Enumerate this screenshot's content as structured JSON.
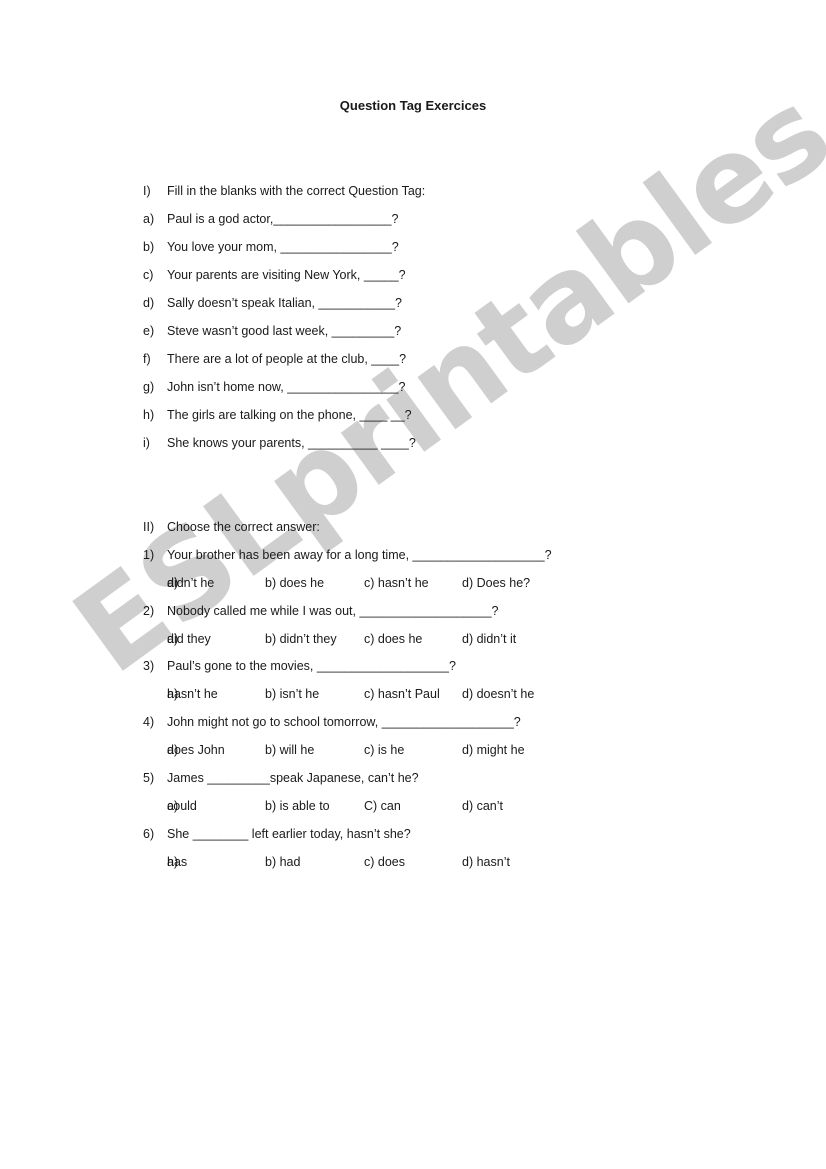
{
  "watermark": "ESLprintables.com",
  "title": "Question Tag Exercices",
  "section1": {
    "num": "I)",
    "heading": "Fill in the blanks with the correct Question Tag:",
    "items": [
      {
        "num": "a)",
        "text": "Paul is a god actor,_________________?"
      },
      {
        "num": "b)",
        "text": "You love your mom, ________________?"
      },
      {
        "num": "c)",
        "text": "Your parents are visiting New York, _____?"
      },
      {
        "num": "d)",
        "text": "Sally doesn’t speak Italian, ___________?"
      },
      {
        "num": "e)",
        "text": "Steve wasn’t good last week, _________?"
      },
      {
        "num": "f)",
        "text": "There are a lot of people at the club, ____?"
      },
      {
        "num": "g)",
        "text": "John isn’t home now, ________________?"
      },
      {
        "num": "h)",
        "text": "The girls are talking on the phone, ____ __?"
      },
      {
        "num": "i)",
        "text": "She knows your parents, __________ ____?"
      }
    ]
  },
  "section2": {
    "num": "II)",
    "heading": "Choose the correct answer:",
    "questions": [
      {
        "num": "1)",
        "text": "Your brother has been away for a long time, ___________________?",
        "options": [
          "a)",
          "didn’t he",
          "b) does he",
          "c) hasn’t he",
          "d) Does he?"
        ]
      },
      {
        "num": "2)",
        "text": "Nobody called me while I was out, ___________________?",
        "options": [
          "a)",
          "did they",
          "b) didn’t they",
          "c) does he",
          "d) didn’t it"
        ]
      },
      {
        "num": "3)",
        "text": "Paul’s gone to the movies, ___________________?",
        "options": [
          "a)",
          "hasn’t he",
          "b) isn’t he",
          "c) hasn’t Paul",
          "d) doesn’t he"
        ]
      },
      {
        "num": "4)",
        "text": "John might not go to school tomorrow, ___________________?",
        "options": [
          "a)",
          "does John",
          "b) will he",
          "c) is he",
          "d) might he"
        ]
      },
      {
        "num": "5)",
        "text": "James _________speak Japanese, can’t he?",
        "options": [
          "a)",
          "could",
          "b) is able to",
          "C) can",
          "d) can’t"
        ]
      },
      {
        "num": "6)",
        "text": "She ________ left earlier today, hasn’t she?",
        "options": [
          "a)",
          "has",
          "b) had",
          "c) does",
          "d) hasn’t"
        ]
      }
    ]
  }
}
